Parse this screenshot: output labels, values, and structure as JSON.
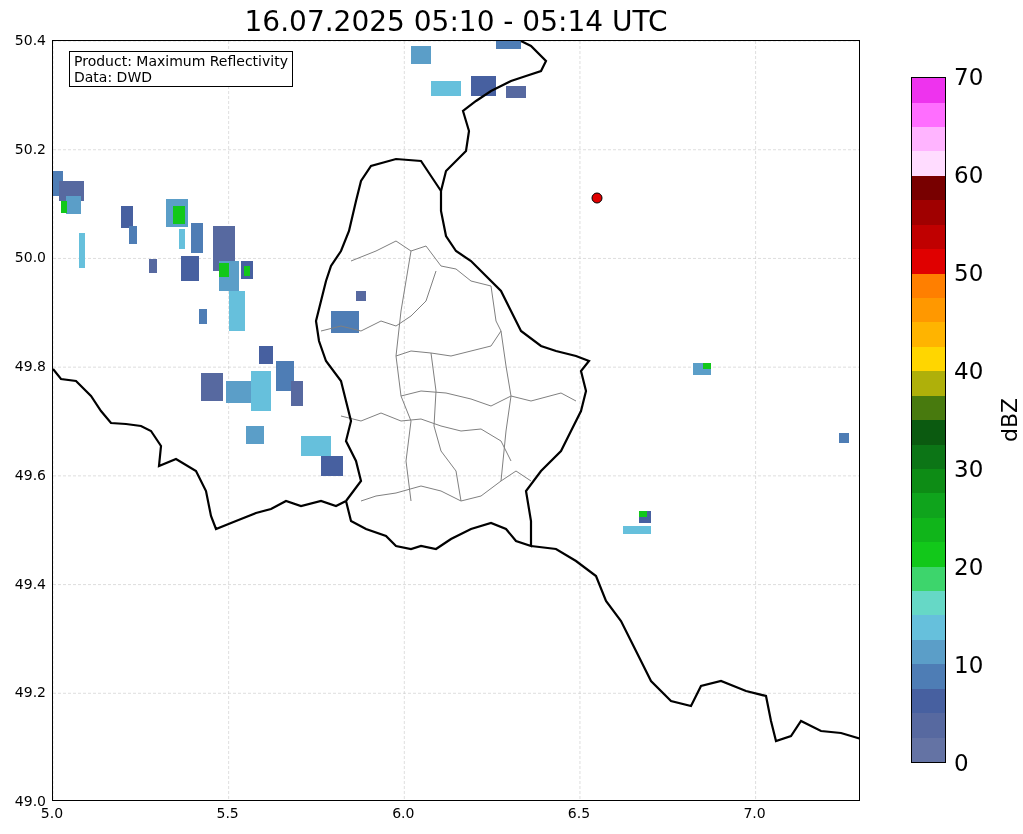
{
  "title": "16.07.2025 05:10 - 05:14 UTC",
  "info_box": {
    "lines": [
      "Product: Maximum Reflectivity",
      "Data: DWD"
    ]
  },
  "x_axis": {
    "ticks": [
      "5.0",
      "5.5",
      "6.0",
      "6.5",
      "7.0"
    ]
  },
  "y_axis": {
    "ticks": [
      "50.4",
      "50.2",
      "50.0",
      "49.8",
      "49.6",
      "49.4",
      "49.2",
      "49.0"
    ]
  },
  "colorbar": {
    "label": "dBZ",
    "ticks": [
      "70",
      "60",
      "50",
      "40",
      "30",
      "20",
      "10",
      "0"
    ],
    "segments": [
      {
        "color": "#6473a4"
      },
      {
        "color": "#5769a0"
      },
      {
        "color": "#4760a0"
      },
      {
        "color": "#4e7db5"
      },
      {
        "color": "#5b9ec8"
      },
      {
        "color": "#66c0dc"
      },
      {
        "color": "#66d8c6"
      },
      {
        "color": "#3dd56c"
      },
      {
        "color": "#12c81a"
      },
      {
        "color": "#10b51a"
      },
      {
        "color": "#0fa41c"
      },
      {
        "color": "#0d8c15"
      },
      {
        "color": "#0c7516"
      },
      {
        "color": "#0b5a10"
      },
      {
        "color": "#487a0e"
      },
      {
        "color": "#afb00a"
      },
      {
        "color": "#ffd600"
      },
      {
        "color": "#ffb400"
      },
      {
        "color": "#ff9800"
      },
      {
        "color": "#ff7f00"
      },
      {
        "color": "#e00000"
      },
      {
        "color": "#c00000"
      },
      {
        "color": "#a00000"
      },
      {
        "color": "#780000"
      },
      {
        "color": "#ffdcff"
      },
      {
        "color": "#ffb4ff"
      },
      {
        "color": "#ff6eff"
      },
      {
        "color": "#ee33ee"
      }
    ]
  }
}
